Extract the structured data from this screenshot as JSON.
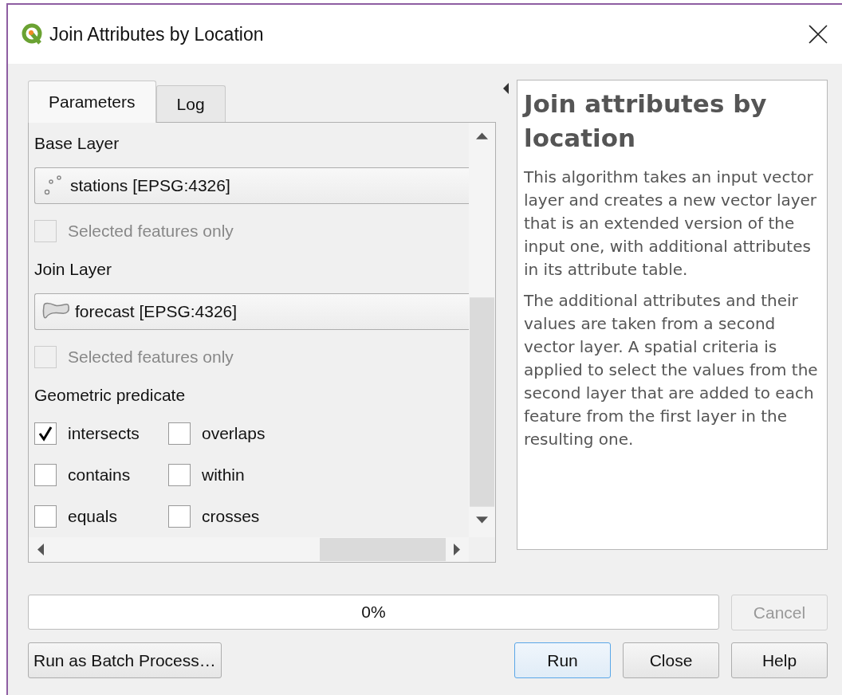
{
  "window": {
    "title": "Join Attributes by Location"
  },
  "tabs": [
    {
      "label": "Parameters",
      "selected": true
    },
    {
      "label": "Log",
      "selected": false
    }
  ],
  "parameters": [
    {
      "kind": "heading",
      "text": "Base Layer"
    },
    {
      "kind": "layer",
      "text": "stations [EPSG:4326]",
      "layer_icon": {
        "kind": "point"
      }
    },
    {
      "kind": "checkbox",
      "text": "Selected features only",
      "checked": false,
      "disabled": true
    },
    {
      "kind": "heading",
      "text": "Join Layer"
    },
    {
      "kind": "layer",
      "text": "forecast [EPSG:4326]",
      "layer_icon": {
        "kind": "polygon"
      }
    },
    {
      "kind": "checkbox",
      "text": "Selected features only",
      "checked": false,
      "disabled": true
    },
    {
      "kind": "heading",
      "text": "Geometric predicate"
    },
    {
      "kind": "grid",
      "items": [
        {
          "text": "intersects",
          "checked": true
        },
        {
          "text": "overlaps",
          "checked": false
        },
        {
          "text": "contains",
          "checked": false
        },
        {
          "text": "within",
          "checked": false
        },
        {
          "text": "equals",
          "checked": false
        },
        {
          "text": "crosses",
          "checked": false
        }
      ]
    }
  ],
  "help": {
    "title": "Join attributes by location",
    "paragraphs": [
      "This algorithm takes an input vector layer and creates a new vector layer that is an extended version of the input one, with additional attributes in its attribute table.",
      "The additional attributes and their values are taken from a second vector layer. A spatial criteria is applied to select the values from the second layer that are added to each feature from the first layer in the resulting one."
    ]
  },
  "progress": {
    "level": 0,
    "text": "0%"
  },
  "cancel": {
    "label": "Cancel",
    "disabled": true
  },
  "buttons": [
    {
      "label": "Run as Batch Process…",
      "default": false
    },
    {
      "label": "Run",
      "default": true
    },
    {
      "label": "Close",
      "default": false
    },
    {
      "label": "Help",
      "default": false
    }
  ]
}
